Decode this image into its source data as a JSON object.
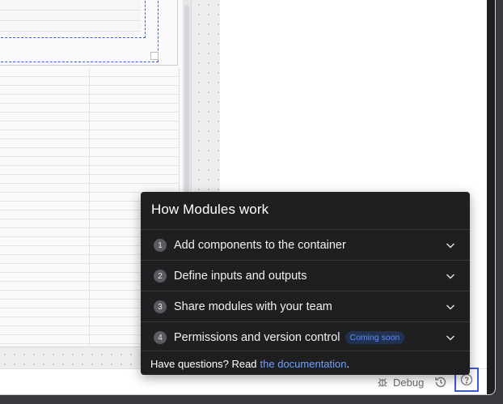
{
  "popover": {
    "title": "How Modules work",
    "items": [
      {
        "number": "1",
        "label": "Add components to the container",
        "badge": ""
      },
      {
        "number": "2",
        "label": "Define inputs and outputs",
        "badge": ""
      },
      {
        "number": "3",
        "label": "Share modules with your team",
        "badge": ""
      },
      {
        "number": "4",
        "label": "Permissions and version control",
        "badge": "Coming soon"
      }
    ],
    "footer_text": "Have questions? Read",
    "footer_link": "the documentation",
    "footer_end": "."
  },
  "statusbar": {
    "debug_label": "Debug"
  },
  "icons": {
    "debug": "bug-icon",
    "history": "history-icon",
    "help": "help-circle-icon",
    "chevron": "chevron-down-icon"
  },
  "colors": {
    "popover_bg": "#1f1f21",
    "link": "#6ea1ff",
    "selection": "#3d5bd8"
  }
}
